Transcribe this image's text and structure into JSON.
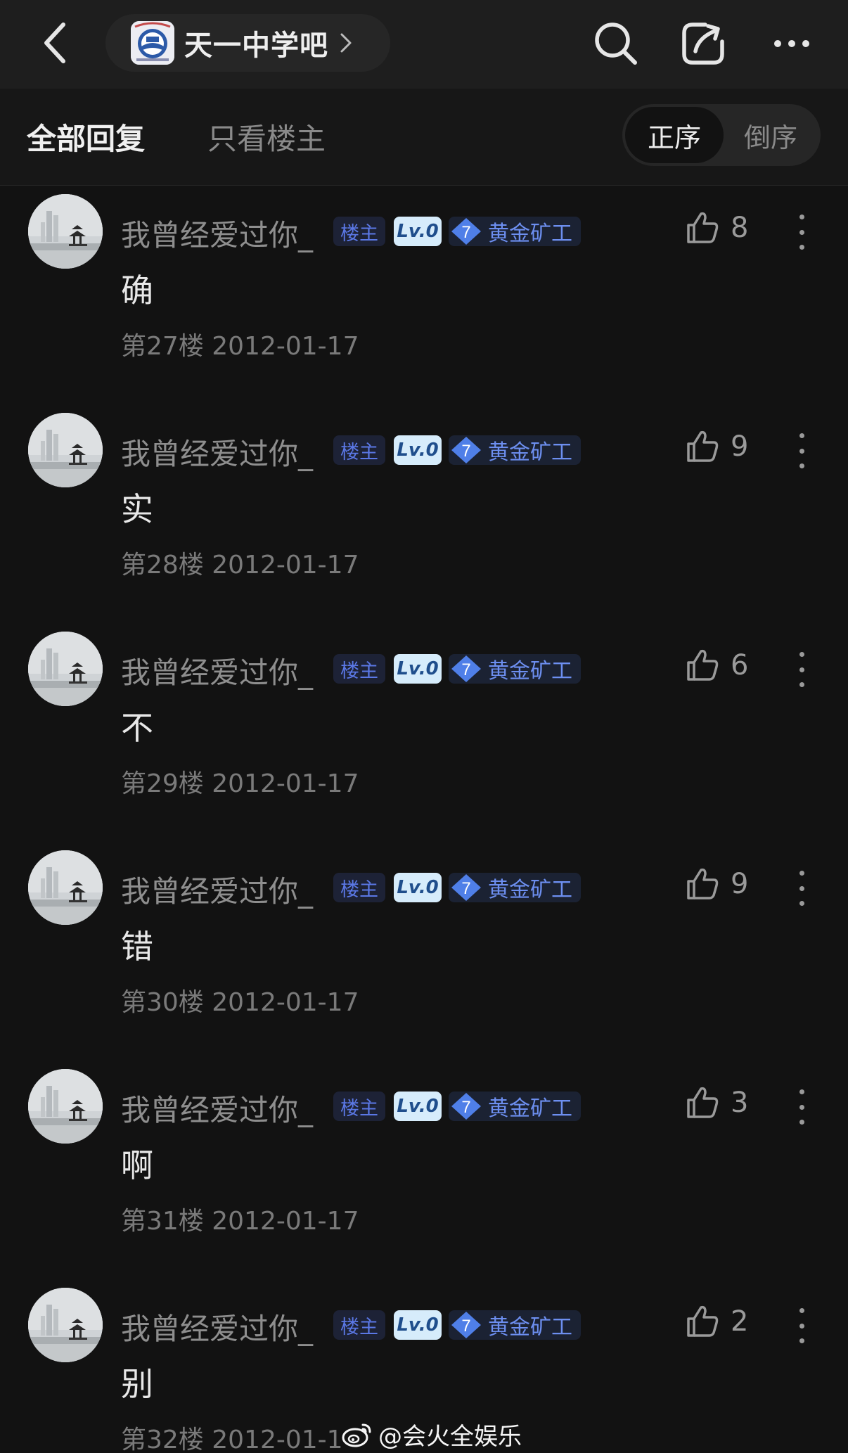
{
  "header": {
    "forum_name": "天一中学吧",
    "icons": [
      "back-icon",
      "search-icon",
      "share-icon",
      "more-icon"
    ]
  },
  "tabs": {
    "all_replies": "全部回复",
    "op_only": "只看楼主",
    "order_asc": "正序",
    "order_desc": "倒序"
  },
  "posts": [
    {
      "author": "我曾经爱过你_",
      "op_badge": "楼主",
      "level": "Lv.0",
      "rank_number": "7",
      "rank_title": "黄金矿工",
      "likes": "8",
      "content": "确",
      "meta": "第27楼 2012-01-17"
    },
    {
      "author": "我曾经爱过你_",
      "op_badge": "楼主",
      "level": "Lv.0",
      "rank_number": "7",
      "rank_title": "黄金矿工",
      "likes": "9",
      "content": "实",
      "meta": "第28楼 2012-01-17"
    },
    {
      "author": "我曾经爱过你_",
      "op_badge": "楼主",
      "level": "Lv.0",
      "rank_number": "7",
      "rank_title": "黄金矿工",
      "likes": "6",
      "content": "不",
      "meta": "第29楼 2012-01-17"
    },
    {
      "author": "我曾经爱过你_",
      "op_badge": "楼主",
      "level": "Lv.0",
      "rank_number": "7",
      "rank_title": "黄金矿工",
      "likes": "9",
      "content": "错",
      "meta": "第30楼 2012-01-17"
    },
    {
      "author": "我曾经爱过你_",
      "op_badge": "楼主",
      "level": "Lv.0",
      "rank_number": "7",
      "rank_title": "黄金矿工",
      "likes": "3",
      "content": "啊",
      "meta": "第31楼 2012-01-17"
    },
    {
      "author": "我曾经爱过你_",
      "op_badge": "楼主",
      "level": "Lv.0",
      "rank_number": "7",
      "rank_title": "黄金矿工",
      "likes": "2",
      "content": "别",
      "meta": "第32楼 2012-01-1"
    }
  ],
  "watermark": {
    "text": "@会火全娱乐",
    "icon": "weibo-icon"
  },
  "colors": {
    "background": "#121212",
    "header_bg": "#1e1e1e",
    "op_badge_text": "#5b78e6",
    "rank_text": "#6d8ff0",
    "gem": "#4f7fe8",
    "level_bg": "#d6ecfb"
  }
}
